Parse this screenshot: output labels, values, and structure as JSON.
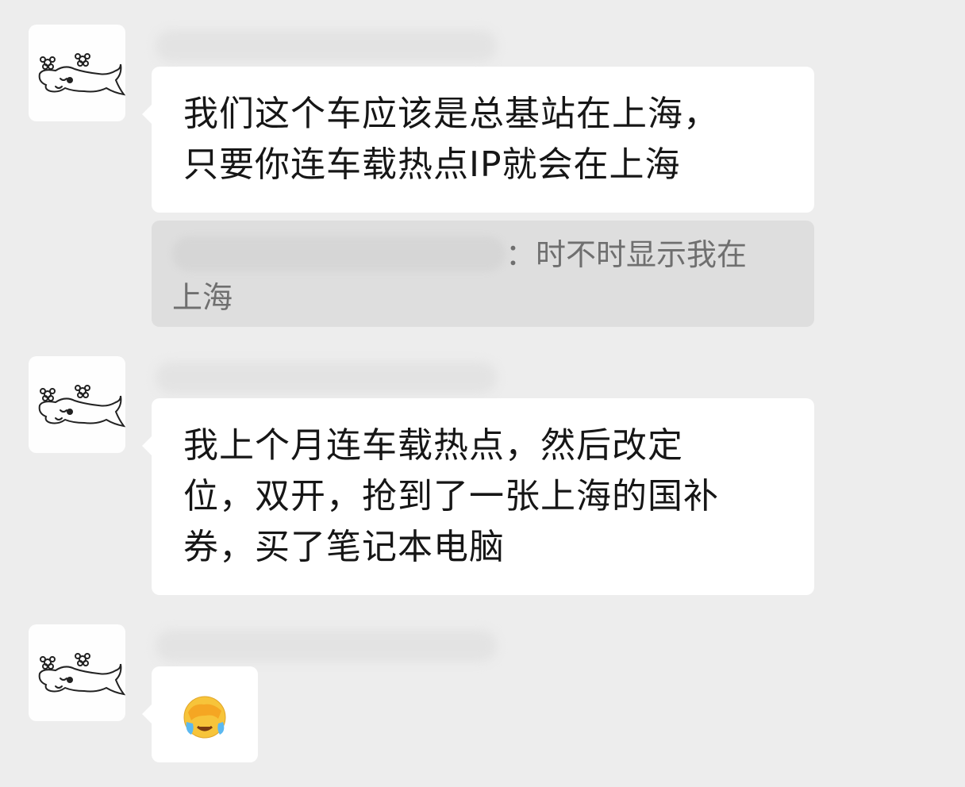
{
  "messages": [
    {
      "avatar_icon": "sketch-dog-avatar-icon",
      "text_lines": [
        "我们这个车应该是总基站在上海，",
        "只要你连车载热点IP就会在上海"
      ],
      "quote": {
        "text": "：时不时显示我在",
        "text_line2": "上海"
      }
    },
    {
      "avatar_icon": "sketch-dog-avatar-icon",
      "text_lines": [
        "我上个月连车载热点，然后改定",
        "位，双开，抢到了一张上海的国补",
        "券，买了笔记本电脑"
      ]
    },
    {
      "avatar_icon": "sketch-dog-avatar-icon",
      "emoji": "face-palm-crying-emoji-icon"
    }
  ],
  "colors": {
    "background": "#ededed",
    "bubble": "#ffffff",
    "quote_bg": "#dedede",
    "text": "#161616",
    "quote_text": "#6f6f6f"
  }
}
